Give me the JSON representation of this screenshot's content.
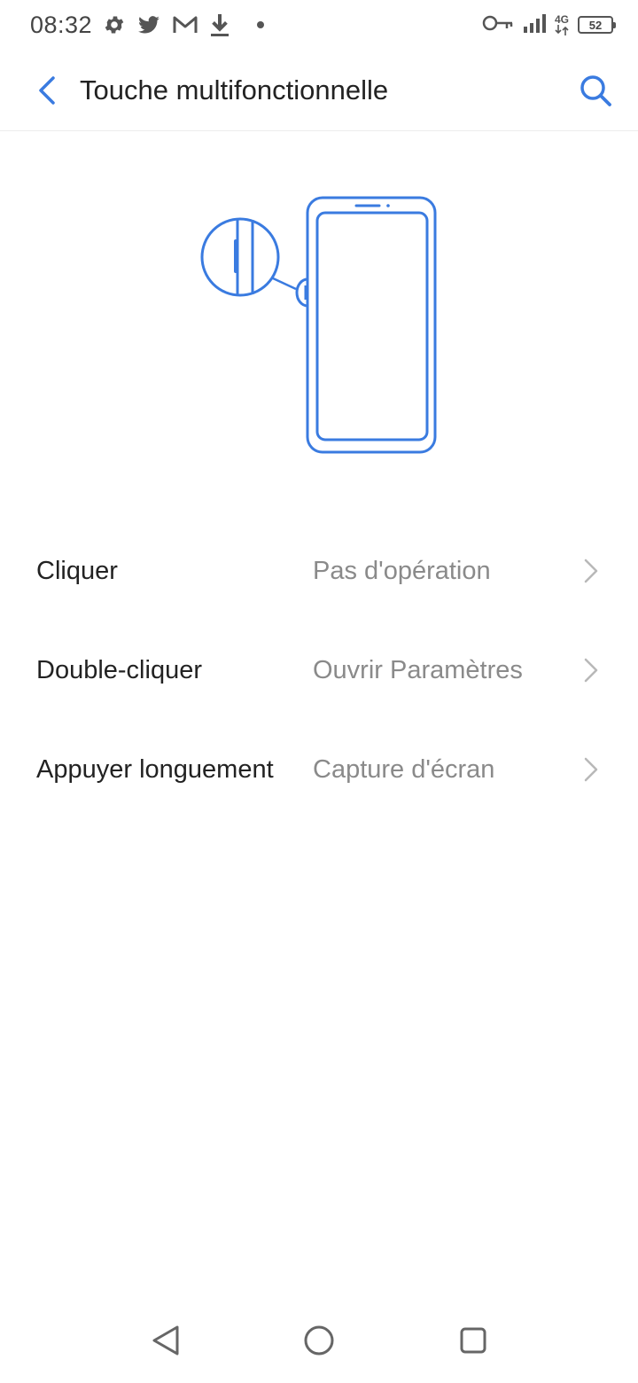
{
  "status_bar": {
    "time": "08:32",
    "network_type": "4G",
    "battery_level": "52",
    "icons": [
      "gear-icon",
      "twitter-icon",
      "gmail-icon",
      "download-icon",
      "dot-icon",
      "vpn-key-icon",
      "signal-icon",
      "battery-icon"
    ]
  },
  "header": {
    "title": "Touche multifonctionnelle",
    "back_icon": "back-arrow-icon",
    "search_icon": "search-icon"
  },
  "illustration": {
    "icon": "phone-side-key-illustration"
  },
  "settings": {
    "items": [
      {
        "label": "Cliquer",
        "value": "Pas d'opération"
      },
      {
        "label": "Double-cliquer",
        "value": "Ouvrir Paramètres"
      },
      {
        "label": "Appuyer longuement",
        "value": "Capture d'écran"
      }
    ]
  },
  "colors": {
    "accent": "#3a7be0",
    "text_primary": "#222222",
    "text_secondary": "#8a8a8a",
    "chevron": "#b8b8b8"
  },
  "nav_bar": {
    "icons": [
      "nav-back-icon",
      "nav-home-icon",
      "nav-recents-icon"
    ]
  }
}
